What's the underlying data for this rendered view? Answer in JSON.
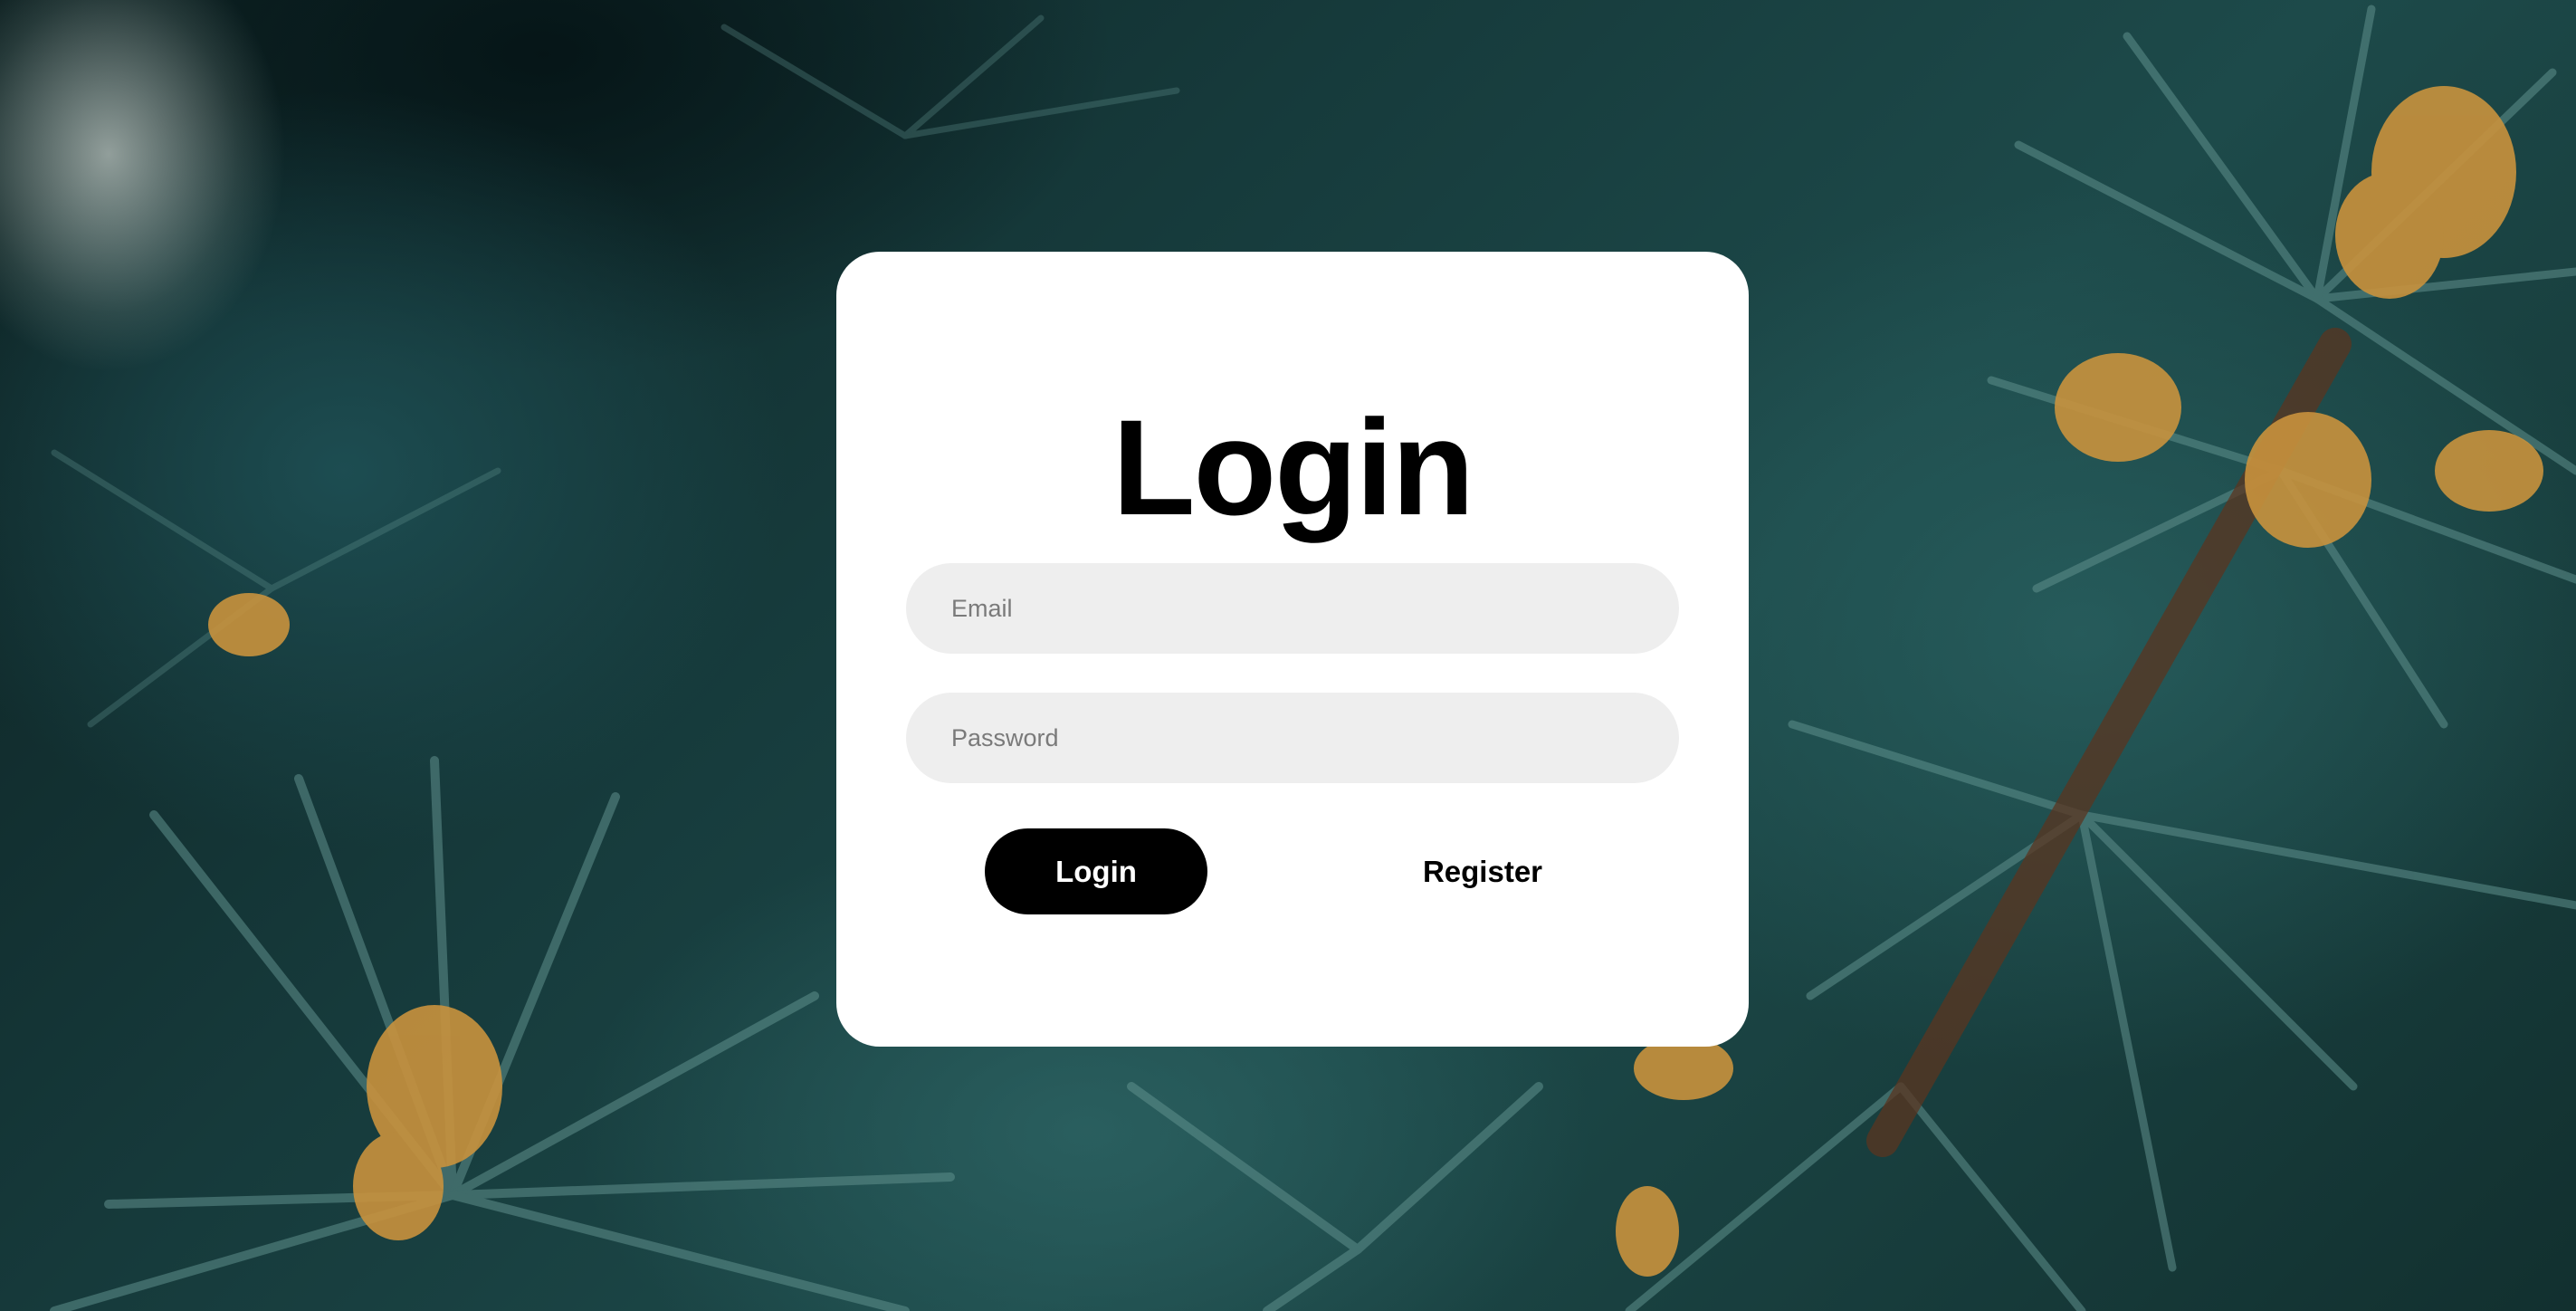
{
  "background": {
    "description_icon": "pine-branch-background"
  },
  "login_card": {
    "title": "Login",
    "email": {
      "placeholder": "Email",
      "value": ""
    },
    "password": {
      "placeholder": "Password",
      "value": ""
    },
    "login_button_label": "Login",
    "register_button_label": "Register"
  },
  "colors": {
    "card": "#ffffff",
    "input_fill": "#eeeeee",
    "primary_button": "#000000",
    "primary_button_text": "#ffffff",
    "text": "#000000"
  }
}
